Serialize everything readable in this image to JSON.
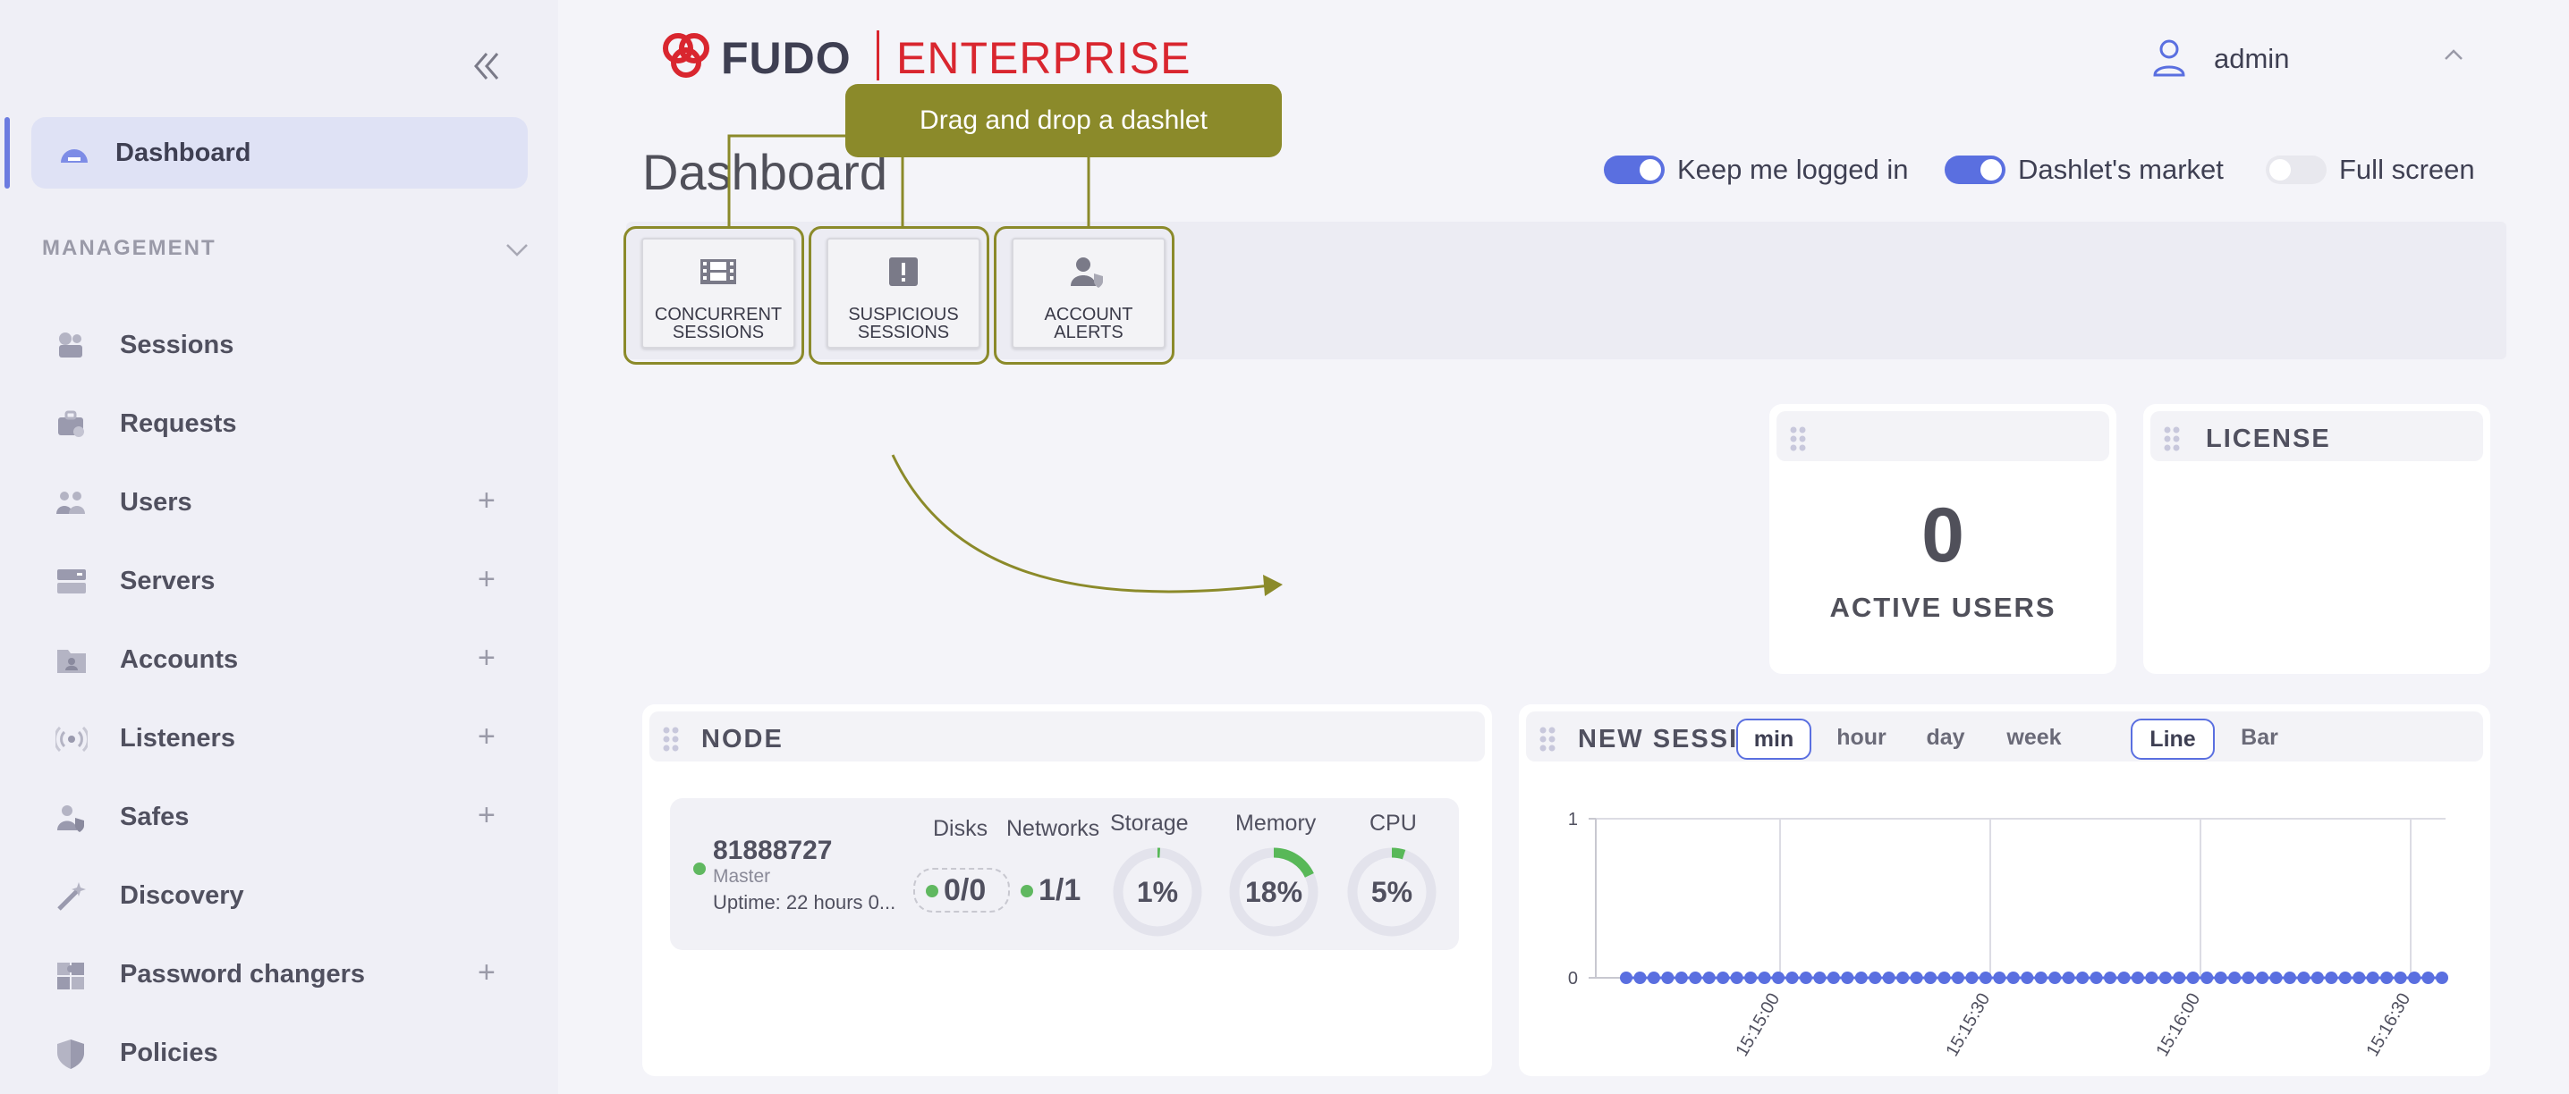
{
  "sidebar": {
    "dashboard_label": "Dashboard",
    "section_label": "MANAGEMENT",
    "items": [
      {
        "label": "Sessions",
        "expandable": false,
        "icon": "camera-icon"
      },
      {
        "label": "Requests",
        "expandable": false,
        "icon": "briefcase-icon"
      },
      {
        "label": "Users",
        "expandable": true,
        "icon": "users-icon"
      },
      {
        "label": "Servers",
        "expandable": true,
        "icon": "server-icon"
      },
      {
        "label": "Accounts",
        "expandable": true,
        "icon": "account-folder-icon"
      },
      {
        "label": "Listeners",
        "expandable": true,
        "icon": "broadcast-icon"
      },
      {
        "label": "Safes",
        "expandable": true,
        "icon": "safe-user-icon"
      },
      {
        "label": "Discovery",
        "expandable": false,
        "icon": "wand-icon"
      },
      {
        "label": "Password changers",
        "expandable": true,
        "icon": "puzzle-icon"
      },
      {
        "label": "Policies",
        "expandable": false,
        "icon": "shield-icon"
      }
    ],
    "plus_symbol": "+"
  },
  "header": {
    "logo_brand": "FUDO",
    "logo_product": "ENTERPRISE",
    "user_name": "admin"
  },
  "page": {
    "title": "Dashboard",
    "toggles": [
      {
        "label": "Keep me logged in",
        "on": true
      },
      {
        "label": "Dashlet's market",
        "on": true
      },
      {
        "label": "Full screen",
        "on": false
      }
    ]
  },
  "market": {
    "tooltip": "Drag and drop a dashlet",
    "dashlets": [
      {
        "line1": "CONCURRENT",
        "line2": "SESSIONS",
        "icon": "film-icon"
      },
      {
        "line1": "SUSPICIOUS",
        "line2": "SESSIONS",
        "icon": "alert-icon"
      },
      {
        "line1": "ACCOUNT",
        "line2": "ALERTS",
        "icon": "user-shield-icon"
      }
    ]
  },
  "active_users": {
    "value": "0",
    "label": "ACTIVE USERS"
  },
  "license": {
    "title": "LICENSE"
  },
  "node": {
    "title": "NODE",
    "id": "81888727",
    "role": "Master",
    "uptime": "Uptime: 22 hours 0...",
    "headers": {
      "disks": "Disks",
      "networks": "Networks",
      "storage": "Storage",
      "memory": "Memory",
      "cpu": "CPU"
    },
    "disks": "0/0",
    "networks": "1/1",
    "gauges": [
      {
        "name": "storage",
        "text": "1%",
        "percent": 1
      },
      {
        "name": "memory",
        "text": "18%",
        "percent": 18
      },
      {
        "name": "cpu",
        "text": "5%",
        "percent": 5
      }
    ]
  },
  "sessions": {
    "title": "NEW SESSIC",
    "ranges": [
      "min",
      "hour",
      "day",
      "week"
    ],
    "selected_range": "min",
    "types": [
      "Line",
      "Bar"
    ],
    "selected_type": "Line"
  },
  "colors": {
    "accent": "#5a6fe0",
    "brand_red": "#d9262f",
    "callout": "#8b8a2a",
    "ok_green": "#60b860"
  },
  "chart_data": {
    "type": "line",
    "ylim": [
      0,
      1
    ],
    "y_ticks": [
      "0",
      "1"
    ],
    "x_ticks": [
      "15:15:00",
      "15:15:30",
      "15:16:00",
      "15:16:30"
    ],
    "point_count": 60,
    "values_constant": 0
  }
}
